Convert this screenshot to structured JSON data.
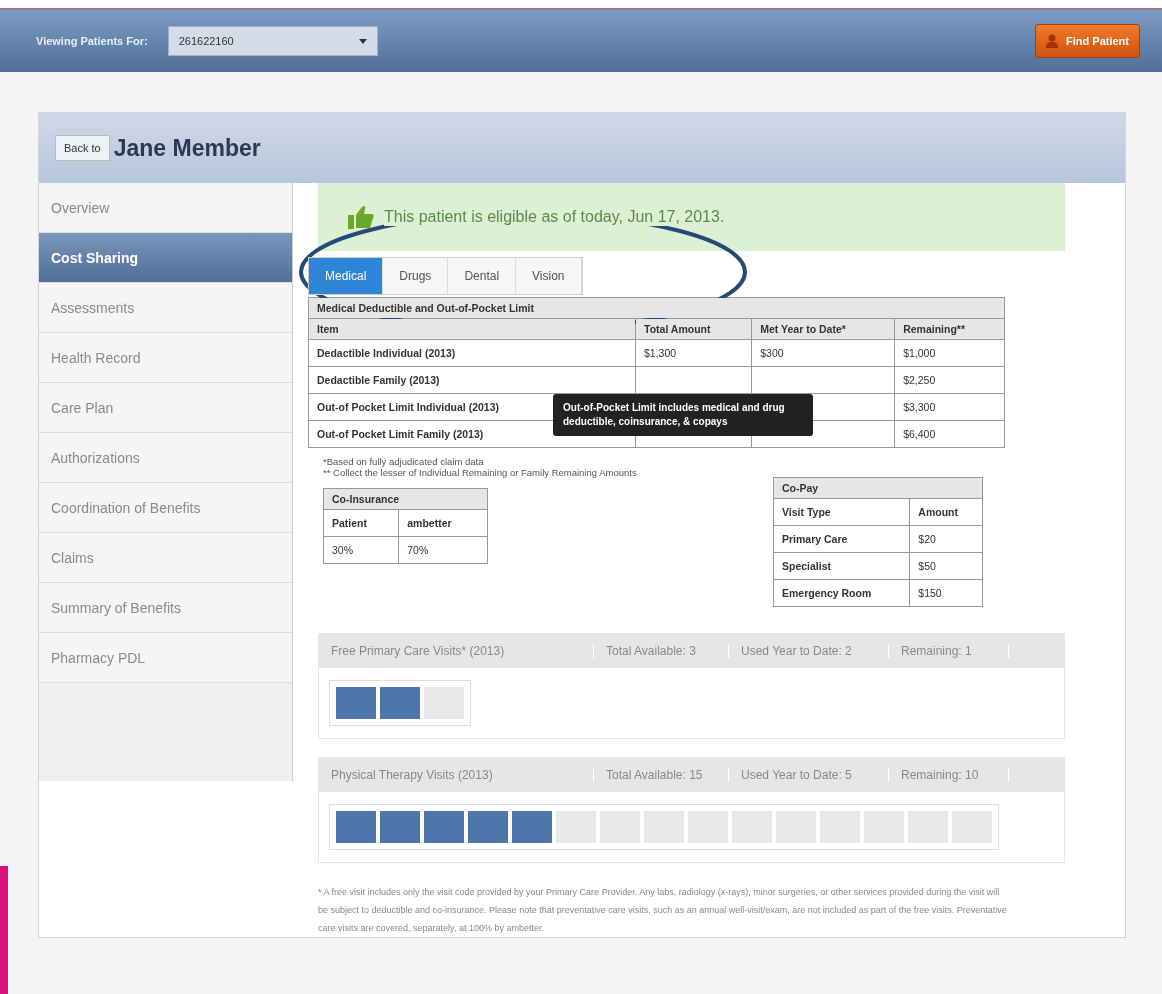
{
  "top_bar": {
    "label": "Viewing Patients For:",
    "patient_select": "261622160",
    "find_button": "Find Patient"
  },
  "header": {
    "back_button": "Back to",
    "title": "Jane Member"
  },
  "sidebar": {
    "items": [
      {
        "label": "Overview",
        "selected": false
      },
      {
        "label": "Cost Sharing",
        "selected": true
      },
      {
        "label": "Assessments",
        "selected": false
      },
      {
        "label": "Health Record",
        "selected": false
      },
      {
        "label": "Care Plan",
        "selected": false
      },
      {
        "label": "Authorizations",
        "selected": false
      },
      {
        "label": "Coordination of Benefits",
        "selected": false
      },
      {
        "label": "Claims",
        "selected": false
      },
      {
        "label": "Summary of Benefits",
        "selected": false
      },
      {
        "label": "Pharmacy PDL",
        "selected": false
      }
    ]
  },
  "banner": "This patient is eligible as of today, Jun 17, 2013.",
  "tabs": [
    {
      "label": "Medical",
      "selected": true
    },
    {
      "label": "Drugs",
      "selected": false
    },
    {
      "label": "Dental",
      "selected": false
    },
    {
      "label": "Vision",
      "selected": false
    }
  ],
  "deductible_table": {
    "title": "Medical Deductible and Out-of-Pocket Limit",
    "columns": [
      "Item",
      "Total Amount",
      "Met Year to Date*",
      "Remaining**"
    ],
    "rows": [
      [
        "Dedactible Individual (2013)",
        "$1,300",
        "$300",
        "$1,000"
      ],
      [
        "Dedactible Family (2013)",
        null,
        null,
        "$2,250"
      ],
      [
        "Out-of Pocket Limit Individual (2013)",
        null,
        null,
        "$3,300"
      ],
      [
        "Out-of Pocket Limit Family (2013)",
        null,
        null,
        "$6,400"
      ]
    ],
    "tooltip": "Out-of-Pocket Limit includes medical and drug deductible, coinsurance, & copays"
  },
  "footnotes": [
    "*Based on fully adjudicated claim data",
    "** Collect the lesser of Individual Remaining or Family Remaining Amounts"
  ],
  "coinsurance": {
    "title": "Co-Insurance",
    "columns": [
      "Patient",
      "ambetter"
    ],
    "values": [
      "30%",
      "70%"
    ]
  },
  "copay": {
    "title": "Co-Pay",
    "columns": [
      "Visit Type",
      "Amount"
    ],
    "rows": [
      [
        "Primary Care",
        "$20"
      ],
      [
        "Specialist",
        "$50"
      ],
      [
        "Emergency Room",
        "$150"
      ]
    ]
  },
  "visit_panels": [
    {
      "title": "Free Primary Care Visits* (2013)",
      "total": "Total Available: 3",
      "used": "Used Year to Date: 2",
      "remaining": "Remaining: 1",
      "blocks": [
        {
          "filled": true
        },
        {
          "filled": true
        },
        {
          "filled": false
        }
      ]
    },
    {
      "title": "Physical Therapy Visits (2013)",
      "total": "Total Available: 15",
      "used": "Used Year to Date: 5",
      "remaining": "Remaining: 10",
      "blocks": [
        {
          "filled": true
        },
        {
          "filled": true
        },
        {
          "filled": true
        },
        {
          "filled": true
        },
        {
          "filled": true
        },
        {
          "filled": false
        },
        {
          "filled": false
        },
        {
          "filled": false
        },
        {
          "filled": false
        },
        {
          "filled": false
        },
        {
          "filled": false
        },
        {
          "filled": false
        },
        {
          "filled": false
        },
        {
          "filled": false
        },
        {
          "filled": false
        }
      ]
    }
  ],
  "disclaimer": "* A free visit includes only the visit code provided by your Primary Care Provider. Any labs, radiology (x-rays), minor surgeries, or other services provided during the visit will be subject to deductible and co-insurance. Please note that preventative care visits, such as an annual well-visit/exam, are not included as part of the free visits. Preventative care visits are covered, separately, at 100% by ambetter."
}
